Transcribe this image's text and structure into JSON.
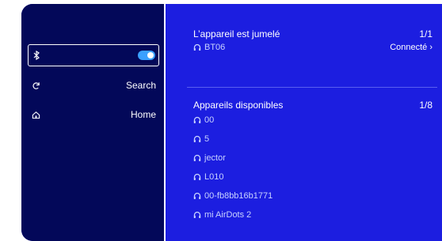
{
  "sidebar": {
    "bluetooth": {
      "icon": "bluetooth-icon",
      "toggle_on": true
    },
    "search": {
      "icon": "refresh-icon",
      "label": "Search"
    },
    "home": {
      "icon": "home-icon",
      "label": "Home"
    }
  },
  "paired": {
    "title": "L’appareil est jumelé",
    "count": "1/1",
    "devices": [
      {
        "icon": "headphones-icon",
        "name": "BT06",
        "status": "Connecté ›"
      }
    ]
  },
  "available": {
    "title": "Appareils disponibles",
    "count": "1/8",
    "devices": [
      {
        "icon": "headphones-icon",
        "name": "00"
      },
      {
        "icon": "headphones-icon",
        "name": "5"
      },
      {
        "icon": "headphones-icon",
        "name": "jector"
      },
      {
        "icon": "headphones-icon",
        "name": "L010"
      },
      {
        "icon": "headphones-icon",
        "name": "00-fb8bb16b1771"
      },
      {
        "icon": "headphones-icon",
        "name": "mi AirDots 2"
      }
    ]
  },
  "colors": {
    "background": "#1c1ee0",
    "sidebar": "#030859",
    "accent": "#3aa0ff"
  }
}
